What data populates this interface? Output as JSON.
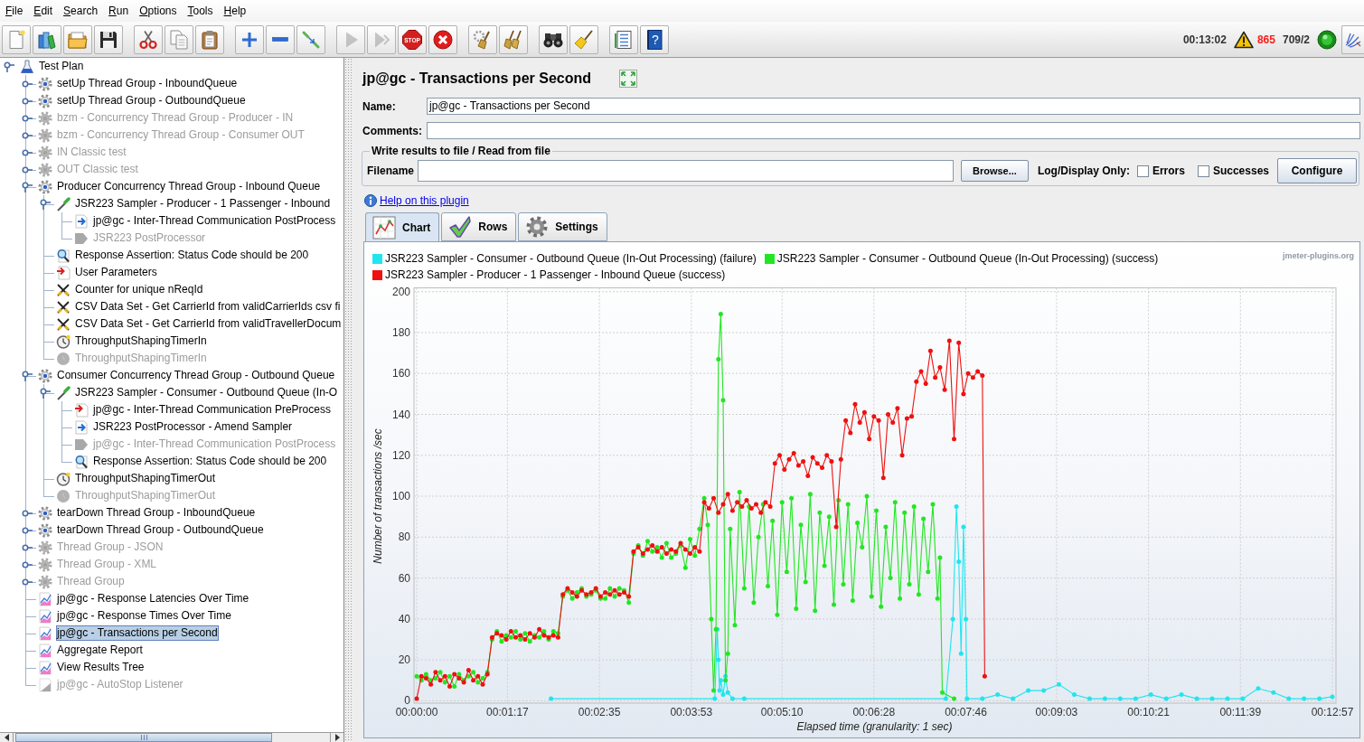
{
  "menu": [
    "File",
    "Edit",
    "Search",
    "Run",
    "Options",
    "Tools",
    "Help"
  ],
  "toolbar": [
    [
      {
        "kind": "new",
        "disabled": false
      },
      {
        "kind": "templates",
        "disabled": false
      },
      {
        "kind": "open",
        "disabled": false
      },
      {
        "kind": "save",
        "disabled": false
      }
    ],
    [
      {
        "kind": "cut",
        "disabled": false
      },
      {
        "kind": "copy",
        "disabled": false
      },
      {
        "kind": "paste",
        "disabled": false
      }
    ],
    [
      {
        "kind": "expand",
        "disabled": false
      },
      {
        "kind": "collapse",
        "disabled": false
      },
      {
        "kind": "toggle",
        "disabled": false
      }
    ],
    [
      {
        "kind": "start",
        "disabled": true
      },
      {
        "kind": "start-no-pauses",
        "disabled": true
      },
      {
        "kind": "stop",
        "disabled": false,
        "text": "STOP"
      },
      {
        "kind": "shutdown",
        "disabled": false
      }
    ],
    [
      {
        "kind": "clear",
        "disabled": false
      },
      {
        "kind": "clear-all",
        "disabled": false
      }
    ],
    [
      {
        "kind": "search",
        "disabled": false
      },
      {
        "kind": "reset-search",
        "disabled": false
      }
    ],
    [
      {
        "kind": "function-helper",
        "disabled": false
      },
      {
        "kind": "help",
        "disabled": false,
        "text": "?"
      }
    ]
  ],
  "status": {
    "elapsed": "00:13:02",
    "warnings": "865",
    "threads": "709/2",
    "running": true
  },
  "tree": [
    {
      "label": "Test Plan",
      "kind": "test-plan",
      "enabled": true,
      "selected": false,
      "expanded": true,
      "children": [
        {
          "label": "setUp Thread Group - InboundQueue",
          "kind": "thread-group",
          "enabled": true,
          "selected": false,
          "expanded": false
        },
        {
          "label": "setUp Thread Group - OutboundQueue",
          "kind": "thread-group",
          "enabled": true,
          "selected": false,
          "expanded": false
        },
        {
          "label": "bzm - Concurrency Thread Group - Producer - IN",
          "kind": "thread-group",
          "enabled": false,
          "selected": false,
          "expanded": false
        },
        {
          "label": "bzm - Concurrency Thread Group - Consumer OUT",
          "kind": "thread-group",
          "enabled": false,
          "selected": false,
          "expanded": false
        },
        {
          "label": "IN Classic test",
          "kind": "thread-group",
          "enabled": false,
          "selected": false,
          "expanded": false
        },
        {
          "label": "OUT Classic test",
          "kind": "thread-group",
          "enabled": false,
          "selected": false,
          "expanded": false
        },
        {
          "label": "Producer Concurrency Thread Group - Inbound Queue",
          "kind": "thread-group",
          "enabled": true,
          "selected": false,
          "expanded": true,
          "children": [
            {
              "label": "JSR223 Sampler - Producer - 1 Passenger - Inbound",
              "kind": "sampler",
              "enabled": true,
              "selected": false,
              "expanded": true,
              "children": [
                {
                  "label": "jp@gc - Inter-Thread Communication PostProcess",
                  "kind": "post-processor",
                  "enabled": true,
                  "selected": false
                },
                {
                  "label": "JSR223 PostProcessor",
                  "kind": "post-processor",
                  "enabled": false,
                  "selected": false
                }
              ]
            },
            {
              "label": "Response Assertion: Status Code should be 200",
              "kind": "assertion",
              "enabled": true,
              "selected": false
            },
            {
              "label": "User Parameters",
              "kind": "pre-processor",
              "enabled": true,
              "selected": false
            },
            {
              "label": "Counter for unique nReqId",
              "kind": "config",
              "enabled": true,
              "selected": false
            },
            {
              "label": "CSV Data Set - Get CarrierId from validCarrierIds csv fi",
              "kind": "config",
              "enabled": true,
              "selected": false
            },
            {
              "label": "CSV Data Set - Get CarrierId from validTravellerDocum",
              "kind": "config",
              "enabled": true,
              "selected": false
            },
            {
              "label": "ThroughputShapingTimerIn",
              "kind": "timer",
              "enabled": true,
              "selected": false
            },
            {
              "label": "ThroughputShapingTimerIn",
              "kind": "timer",
              "enabled": false,
              "selected": false
            }
          ]
        },
        {
          "label": "Consumer Concurrency Thread Group - Outbound Queue",
          "kind": "thread-group",
          "enabled": true,
          "selected": false,
          "expanded": true,
          "children": [
            {
              "label": "JSR223 Sampler - Consumer - Outbound Queue (In-O",
              "kind": "sampler",
              "enabled": true,
              "selected": false,
              "expanded": true,
              "children": [
                {
                  "label": "jp@gc - Inter-Thread Communication PreProcess",
                  "kind": "pre-processor",
                  "enabled": true,
                  "selected": false
                },
                {
                  "label": "JSR223 PostProcessor - Amend Sampler",
                  "kind": "post-processor",
                  "enabled": true,
                  "selected": false
                },
                {
                  "label": "jp@gc - Inter-Thread Communication PostProcess",
                  "kind": "post-processor",
                  "enabled": false,
                  "selected": false
                },
                {
                  "label": "Response Assertion: Status Code should be 200",
                  "kind": "assertion",
                  "enabled": true,
                  "selected": false
                }
              ]
            },
            {
              "label": "ThroughputShapingTimerOut",
              "kind": "timer",
              "enabled": true,
              "selected": false
            },
            {
              "label": "ThroughputShapingTimerOut",
              "kind": "timer",
              "enabled": false,
              "selected": false
            }
          ]
        },
        {
          "label": "tearDown Thread Group - InboundQueue",
          "kind": "thread-group",
          "enabled": true,
          "selected": false,
          "expanded": false
        },
        {
          "label": "tearDown Thread Group - OutboundQueue",
          "kind": "thread-group",
          "enabled": true,
          "selected": false,
          "expanded": false
        },
        {
          "label": "Thread Group - JSON",
          "kind": "thread-group",
          "enabled": false,
          "selected": false,
          "expanded": false
        },
        {
          "label": "Thread Group - XML",
          "kind": "thread-group",
          "enabled": false,
          "selected": false,
          "expanded": false
        },
        {
          "label": "Thread Group",
          "kind": "thread-group",
          "enabled": false,
          "selected": false,
          "expanded": false
        },
        {
          "label": "jp@gc - Response Latencies Over Time",
          "kind": "listener",
          "enabled": true,
          "selected": false
        },
        {
          "label": "jp@gc - Response Times Over Time",
          "kind": "listener",
          "enabled": true,
          "selected": false
        },
        {
          "label": "jp@gc - Transactions per Second",
          "kind": "listener",
          "enabled": true,
          "selected": true
        },
        {
          "label": "Aggregate Report",
          "kind": "listener",
          "enabled": true,
          "selected": false
        },
        {
          "label": "View Results Tree",
          "kind": "listener",
          "enabled": true,
          "selected": false
        },
        {
          "label": "jp@gc - AutoStop Listener",
          "kind": "listener",
          "enabled": false,
          "selected": false
        }
      ]
    }
  ],
  "panel": {
    "title": "jp@gc - Transactions per Second",
    "fields": [
      {
        "label": "Name:",
        "value": "jp@gc - Transactions per Second"
      },
      {
        "label": "Comments:"
      }
    ],
    "file_box": {
      "legend": "Write results to file / Read from file",
      "filename_label": "Filename",
      "browse_button": "Browse...",
      "log_label": "Log/Display Only:",
      "options": [
        {
          "label": "Errors",
          "checked": false
        },
        {
          "label": "Successes",
          "checked": false
        }
      ],
      "configure_button": "Configure"
    },
    "help_link": "Help on this plugin",
    "tabs": [
      {
        "label": "Chart",
        "selected": true
      },
      {
        "label": "Rows",
        "selected": false
      },
      {
        "label": "Settings",
        "selected": false
      }
    ],
    "chart_data": [
      {
        "type": "line",
        "xlabel": "Elapsed time (granularity: 1 sec)",
        "ylabel": "Number of transactions /sec",
        "legend": "top",
        "grid": true,
        "xlim": [
          0,
          777
        ],
        "ylim": [
          0,
          200
        ],
        "xticks": [
          {
            "value": 0,
            "label": "00:00:00"
          },
          {
            "value": 77,
            "label": "00:01:17"
          },
          {
            "value": 155,
            "label": "00:02:35"
          },
          {
            "value": 233,
            "label": "00:03:53"
          },
          {
            "value": 310,
            "label": "00:05:10"
          },
          {
            "value": 388,
            "label": "00:06:28"
          },
          {
            "value": 466,
            "label": "00:07:46"
          },
          {
            "value": 543,
            "label": "00:09:03"
          },
          {
            "value": 621,
            "label": "00:10:21"
          },
          {
            "value": 699,
            "label": "00:11:39"
          },
          {
            "value": 777,
            "label": "00:12:57"
          }
        ],
        "yticks": [
          0,
          20,
          40,
          60,
          80,
          100,
          120,
          140,
          160,
          180,
          200
        ],
        "annotations": [
          "jmeter-plugins.org"
        ],
        "series": [
          {
            "name": "JSR223 Sampler - Consumer - Outbound Queue (In-Out Processing) (failure)",
            "color": "#1ee6f0",
            "x": [
              114,
              253,
              255,
              256,
              257,
              258,
              260,
              262,
              264,
              268,
              278,
              449,
              455,
              458,
              460,
              462,
              464,
              466,
              467,
              480,
              493,
              506,
              519,
              532,
              545,
              558,
              571,
              584,
              597,
              610,
              623,
              636,
              649,
              662,
              675,
              688,
              701,
              714,
              727,
              740,
              753,
              766,
              777
            ],
            "values": [
              1,
              1,
              35,
              20,
              5,
              10,
              3,
              12,
              4,
              1,
              1,
              1,
              40,
              95,
              68,
              23,
              85,
              40,
              1,
              1,
              3,
              1,
              5,
              5,
              8,
              3,
              1,
              1,
              1,
              1,
              3,
              1,
              3,
              1,
              1,
              1,
              1,
              6,
              4,
              1,
              1,
              1,
              2
            ]
          },
          {
            "name": "JSR223 Sampler - Consumer - Outbound Queue (In-Out Processing) (success)",
            "color": "#22e622",
            "x": [
              0,
              4,
              8,
              12,
              16,
              20,
              24,
              28,
              32,
              36,
              40,
              44,
              48,
              52,
              56,
              60,
              64,
              68,
              72,
              76,
              80,
              84,
              88,
              92,
              96,
              100,
              104,
              108,
              112,
              116,
              120,
              124,
              128,
              132,
              136,
              140,
              144,
              148,
              152,
              156,
              160,
              164,
              168,
              172,
              176,
              180,
              184,
              188,
              192,
              196,
              200,
              204,
              208,
              212,
              216,
              220,
              224,
              228,
              232,
              236,
              240,
              244,
              247,
              250,
              252,
              254,
              256,
              258,
              260,
              262,
              264,
              266,
              270,
              274,
              278,
              282,
              286,
              290,
              294,
              298,
              302,
              306,
              310,
              314,
              318,
              322,
              326,
              330,
              334,
              338,
              342,
              346,
              350,
              354,
              358,
              362,
              366,
              370,
              374,
              378,
              382,
              386,
              390,
              394,
              398,
              402,
              406,
              410,
              414,
              418,
              422,
              426,
              430,
              434,
              438,
              442,
              444,
              446,
              456
            ],
            "values": [
              12,
              10,
              13,
              10,
              11,
              14,
              9,
              12,
              7,
              13,
              10,
              12,
              14,
              9,
              11,
              14,
              30,
              34,
              29,
              32,
              31,
              34,
              30,
              33,
              29,
              32,
              31,
              34,
              30,
              34,
              33,
              51,
              54,
              50,
              53,
              55,
              51,
              52,
              54,
              50,
              50,
              55,
              51,
              55,
              54,
              48,
              72,
              76,
              71,
              78,
              73,
              75,
              70,
              77,
              70,
              72,
              76,
              65,
              79,
              71,
              84,
              99,
              86,
              40,
              5,
              35,
              167,
              189,
              147,
              10,
              23,
              84,
              37,
              102,
              55,
              95,
              48,
              80,
              96,
              56,
              88,
              42,
              97,
              63,
              99,
              45,
              86,
              58,
              101,
              44,
              92,
              66,
              90,
              47,
              98,
              57,
              96,
              49,
              87,
              75,
              100,
              51,
              93,
              46,
              85,
              60,
              97,
              50,
              92,
              57,
              95,
              52,
              89,
              63,
              96,
              50,
              70,
              4,
              1
            ]
          },
          {
            "name": "JSR223 Sampler - Producer - 1 Passenger - Inbound Queue (success)",
            "color": "#f01010",
            "x": [
              0,
              4,
              8,
              12,
              16,
              20,
              24,
              28,
              32,
              36,
              40,
              44,
              48,
              52,
              56,
              60,
              64,
              68,
              72,
              76,
              80,
              84,
              88,
              92,
              96,
              100,
              104,
              108,
              112,
              116,
              120,
              124,
              128,
              132,
              136,
              140,
              144,
              148,
              152,
              156,
              160,
              164,
              168,
              172,
              176,
              180,
              184,
              188,
              192,
              196,
              200,
              204,
              208,
              212,
              216,
              220,
              224,
              228,
              232,
              236,
              240,
              244,
              248,
              252,
              256,
              260,
              264,
              268,
              272,
              276,
              280,
              284,
              288,
              292,
              296,
              300,
              304,
              308,
              312,
              316,
              320,
              324,
              328,
              332,
              336,
              340,
              344,
              348,
              352,
              356,
              360,
              364,
              368,
              372,
              376,
              380,
              384,
              388,
              392,
              396,
              400,
              404,
              408,
              412,
              416,
              420,
              424,
              428,
              432,
              436,
              440,
              444,
              448,
              452,
              456,
              460,
              464,
              468,
              472,
              476,
              480,
              482
            ],
            "values": [
              1,
              12,
              11,
              8,
              14,
              10,
              12,
              7,
              13,
              11,
              9,
              15,
              10,
              12,
              8,
              13,
              31,
              33,
              32,
              30,
              34,
              31,
              32,
              30,
              33,
              31,
              35,
              32,
              31,
              32,
              31,
              52,
              55,
              53,
              51,
              54,
              52,
              53,
              55,
              51,
              53,
              52,
              54,
              52,
              53,
              51,
              73,
              75,
              72,
              74,
              76,
              73,
              75,
              72,
              74,
              73,
              77,
              74,
              72,
              75,
              73,
              97,
              94,
              99,
              92,
              96,
              101,
              93,
              97,
              95,
              98,
              94,
              96,
              92,
              97,
              95,
              116,
              120,
              113,
              118,
              121,
              115,
              117,
              110,
              119,
              116,
              114,
              120,
              117,
              85,
              118,
              137,
              131,
              145,
              136,
              141,
              128,
              139,
              137,
              109,
              140,
              136,
              143,
              120,
              138,
              139,
              156,
              161,
              155,
              171,
              158,
              163,
              152,
              176,
              128,
              175,
              150,
              160,
              158,
              161,
              159,
              12
            ]
          }
        ]
      }
    ]
  }
}
